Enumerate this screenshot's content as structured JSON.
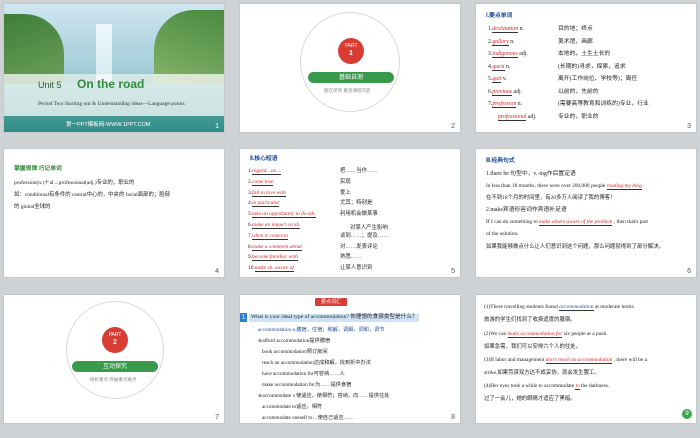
{
  "s1": {
    "unit": "Unit 5",
    "title": "On the road",
    "subtitle": "Period Two    Starting out & Understanding ideas—Language points",
    "site": "第一PPT模板网-WWW.1PPT.COM",
    "page": "1"
  },
  "s2": {
    "part_label": "PART",
    "part_num": "1",
    "bar": "基础自测",
    "caption": "题在单项  重温课程内容",
    "page": "2"
  },
  "s3": {
    "heading": "Ⅰ.要点单词",
    "rows": [
      {
        "num": "1.",
        "word": "destination",
        "pos": " n.",
        "mean": "目的地；终点"
      },
      {
        "num": "2.",
        "word": "gallery",
        "pos": " n.",
        "mean": "美术馆，画廊"
      },
      {
        "num": "3.",
        "word": "indigenous",
        "pos": " adj.",
        "mean": "本地的，土生土长的"
      },
      {
        "num": "4.",
        "word": "quest",
        "pos": " n.",
        "mean": "(长期的)寻求，探索，追求"
      },
      {
        "num": "5.",
        "word": "quit",
        "pos": " v.",
        "mean": "离开(工作岗位、学校等)；离任"
      },
      {
        "num": "6.",
        "word": "previous",
        "pos": " adj.",
        "mean": "以前的，先前的"
      },
      {
        "num": "7.",
        "word": "profession",
        "pos": " n.",
        "mean": "(需要高等教育和训练的)专业，行业"
      },
      {
        "num": "",
        "word": "professional",
        "pos": " adj.",
        "mean": "专业的，职业的"
      }
    ],
    "page": "3"
  },
  "s4": {
    "heading": "掌握规律  巧记单词",
    "line1": "profession(n.)＋al→professional(adj.)专业的，职业的",
    "line2": "如：conditional有条件的  central中心的，中央的  facial面部的；脸部",
    "line3": "的   global全球的",
    "page": "4"
  },
  "s5": {
    "heading": "Ⅱ.核心短语",
    "rows": [
      {
        "num": "1.",
        "phrase": "regard…as…",
        "mean": "把……当作……"
      },
      {
        "num": "2.",
        "phrase": "come true",
        "mean": "实现"
      },
      {
        "num": "3.",
        "phrase": "fall in love with",
        "mean": "爱上"
      },
      {
        "num": "4.",
        "phrase": "in particular",
        "mean": "尤其；特别是"
      },
      {
        "num": "5.",
        "phrase": "take an opportunity to do sth.",
        "mean": "利用机会做某事"
      },
      {
        "num": "6.",
        "phrase": "make an impact on sb.",
        "mean": "对某人产生影响"
      },
      {
        "num": "7.",
        "phrase": "when it comes to",
        "mean": "谈到……；提及……"
      },
      {
        "num": "8.",
        "phrase": "make a comment about",
        "mean": "对……发表评论"
      },
      {
        "num": "9.",
        "phrase": "become familiar with",
        "mean": "熟悉……"
      },
      {
        "num": "10.",
        "phrase": "make sb. aware of",
        "mean": "让某人意识到"
      }
    ],
    "page": "5"
  },
  "s6": {
    "heading": "Ⅲ.经典句式",
    "l1": "1.there be 句型中，v.-ing作后置定语",
    "l2a": "In less than 18 months, there were over 200,000 people",
    "l2b": "reading my blog",
    "l2c": ".",
    "l3": "在不到18个月的时间里，有20多万人阅读了我的博客！",
    "l4": "2.make宾语形容词作宾语补足语",
    "l5a": "If I can do something to",
    "l5b": "make others aware of the problem",
    "l5c": ", then that's part",
    "l6": "of the solution.",
    "l7": "如果我能够做点什么让人们意识到这个问题，那么问题就得到了部分解决。",
    "page": "6"
  },
  "s7": {
    "part_label": "PART",
    "part_num": "2",
    "bar": "互动探究",
    "caption": "研析重点  突破重点难点",
    "page": "7"
  },
  "s8": {
    "tag": "要点词汇",
    "num": "1",
    "q": "What is your ideal type of accommodation? 你理想的食宿类型是什么？",
    "l2": "accommodation n.膳宿，住宿；和解，调解，调和，调节",
    "l3": "※afford accommodation提供膳宿",
    "l4": "book accommodation预订房间",
    "l5": "reach an accommodation达成和解，找到折中办法",
    "l6": "have accommodation for可容纳……人",
    "l7": "make accommodation for为……提供食宿",
    "l8": "※accommodate v.使适应，使相符；容纳，向……提供住处",
    "l9": "accommodate to适应，相符",
    "l10": "accommodate oneself to…使自己适应……",
    "page": "8"
  },
  "s9": {
    "l1a": "(1)There travelling students found",
    "l1b": "accommodation",
    "l1c": "at moderate terms.",
    "l2": "旅游的学生们找到了收费适度的膳宿。",
    "l3a": "(2)We can",
    "l3b": "make accommodation for",
    "l3c": "six people at a push.",
    "l4": "如果急需，我们可以安排六个人的住处。",
    "l5a": "(3)If labor and management",
    "l5b": "don't reach an accommodation",
    "l5c": ", there will be a",
    "l6": "strike.如果劳资双方达不成妥协，就会发生罢工。",
    "l7a": "(4)Her eyes took a while to accommodate",
    "l7b": "to",
    "l7c": "the darkness.",
    "l8": "过了一会儿，她的眼睛才适应了黑暗。",
    "page": "9"
  }
}
